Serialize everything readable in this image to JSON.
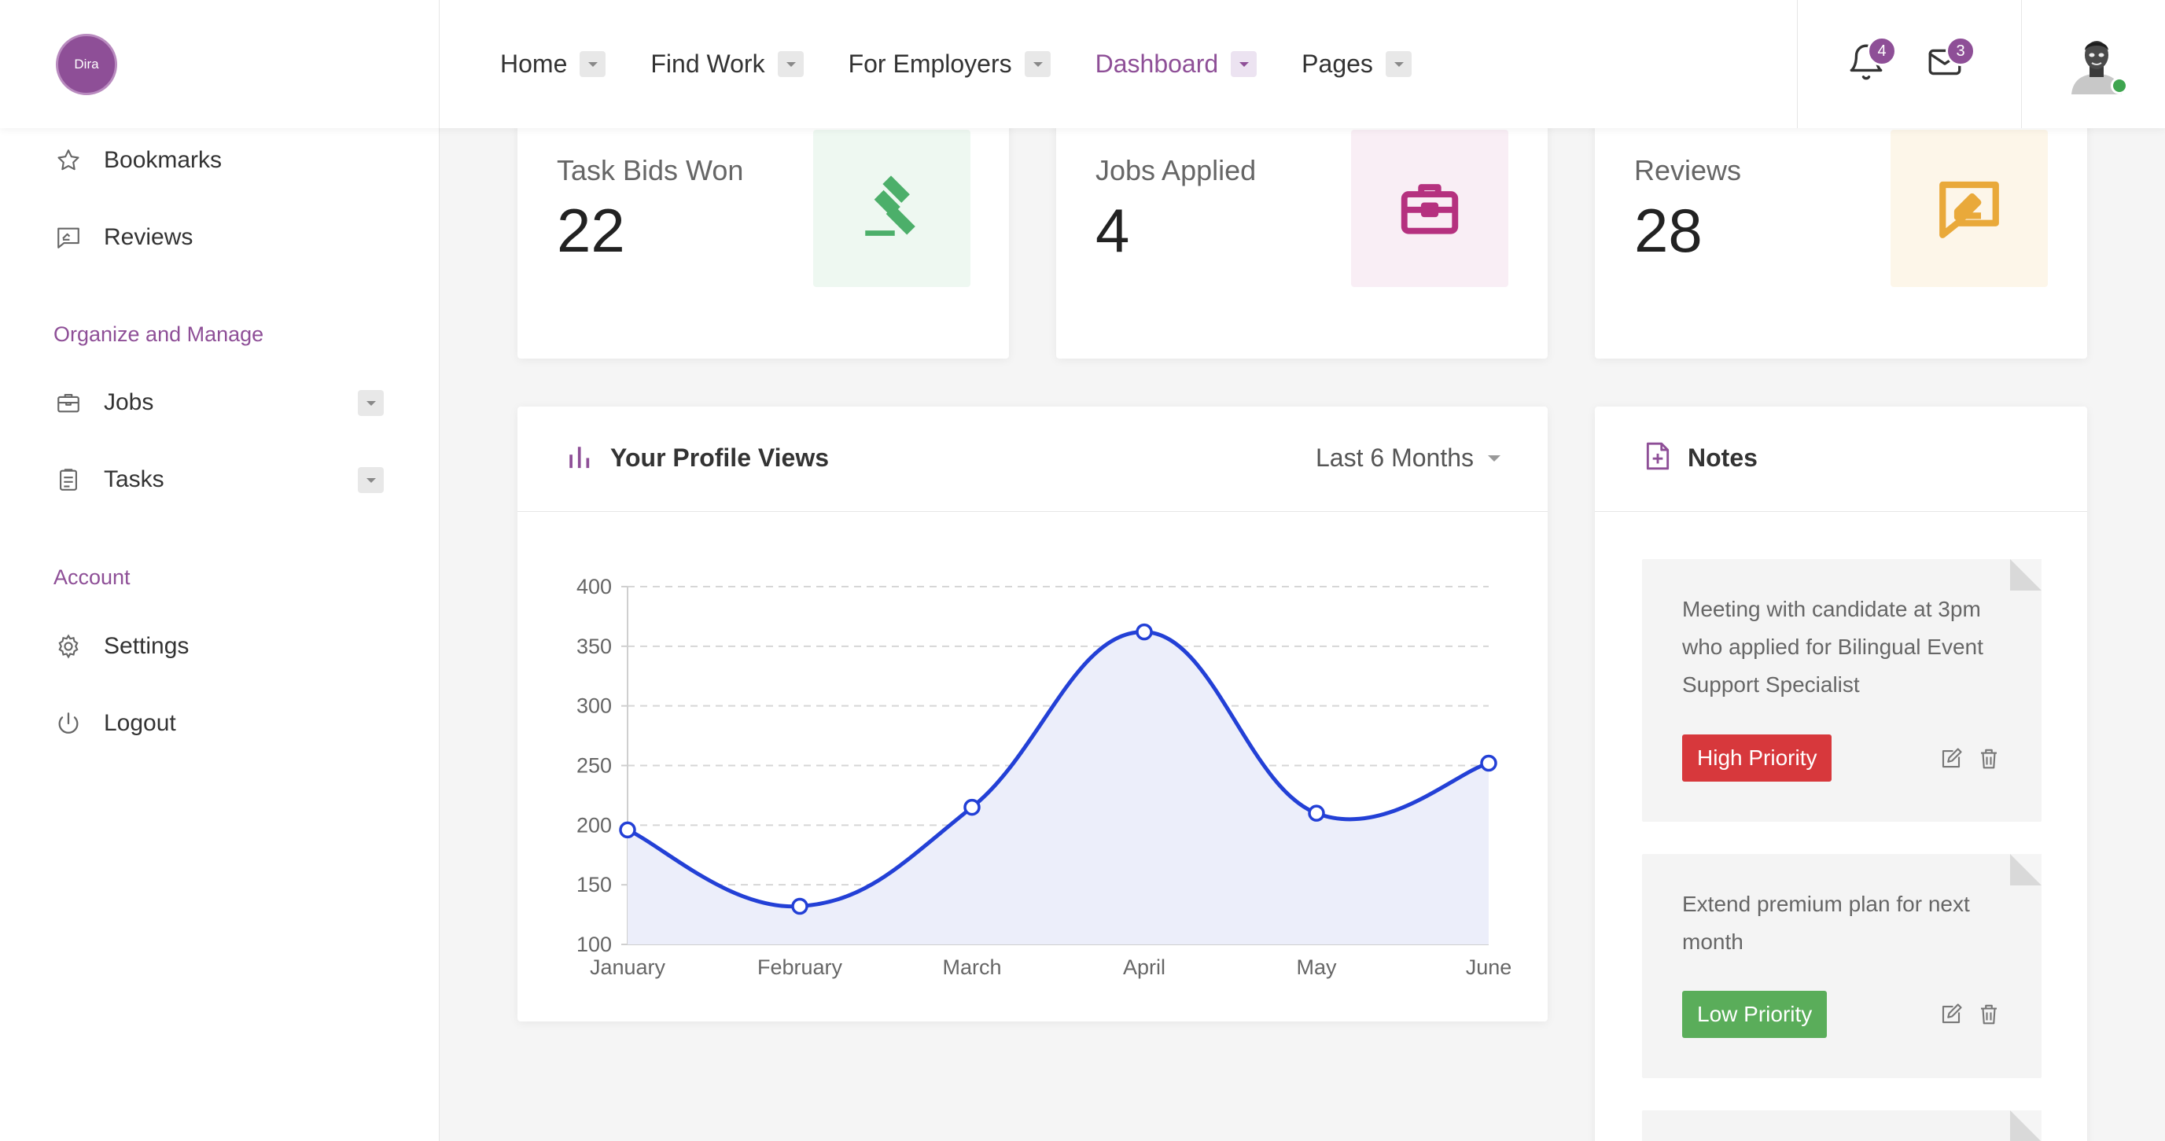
{
  "logo": {
    "text": "Dira"
  },
  "nav": {
    "items": [
      {
        "label": "Home",
        "active": false
      },
      {
        "label": "Find Work",
        "active": false
      },
      {
        "label": "For Employers",
        "active": false
      },
      {
        "label": "Dashboard",
        "active": true
      },
      {
        "label": "Pages",
        "active": false
      }
    ]
  },
  "header": {
    "notifications_count": "4",
    "messages_count": "3",
    "notifications_icon": "bell-icon",
    "messages_icon": "envelope-icon",
    "user_status": "online"
  },
  "sidebar": {
    "items_top": [
      {
        "label": "Bookmarks",
        "icon": "star-icon"
      },
      {
        "label": "Reviews",
        "icon": "review-icon"
      }
    ],
    "section_organize": "Organize and Manage",
    "items_organize": [
      {
        "label": "Jobs",
        "icon": "briefcase-icon",
        "expandable": true
      },
      {
        "label": "Tasks",
        "icon": "clipboard-icon",
        "expandable": true
      }
    ],
    "section_account": "Account",
    "items_account": [
      {
        "label": "Settings",
        "icon": "gear-icon"
      },
      {
        "label": "Logout",
        "icon": "power-icon"
      }
    ]
  },
  "stats": [
    {
      "label": "Task Bids Won",
      "value": "22",
      "icon": "gavel-icon",
      "color": "#4caf6a",
      "bg": "#eef8f1"
    },
    {
      "label": "Jobs Applied",
      "value": "4",
      "icon": "briefcase-icon",
      "color": "#b5317f",
      "bg": "#f9eef5"
    },
    {
      "label": "Reviews",
      "value": "28",
      "icon": "review-icon",
      "color": "#e9a93a",
      "bg": "#fdf6e9"
    }
  ],
  "profile_views": {
    "title": "Your Profile Views",
    "period": "Last 6 Months"
  },
  "chart_data": {
    "type": "area",
    "categories": [
      "January",
      "February",
      "March",
      "April",
      "May",
      "June"
    ],
    "values": [
      196,
      132,
      215,
      362,
      210,
      252
    ],
    "ylim": [
      100,
      400
    ],
    "yticks": [
      100,
      150,
      200,
      250,
      300,
      350,
      400
    ],
    "xlabel": "",
    "ylabel": "",
    "grid": "horizontal-dashed",
    "color": "#2340d6",
    "fill": "#eceefa"
  },
  "notes": {
    "title": "Notes",
    "items": [
      {
        "text": "Meeting with candidate at 3pm who applied for Bilingual Event Support Specialist",
        "priority": "High Priority",
        "color": "#d7383c"
      },
      {
        "text": "Extend premium plan for next month",
        "priority": "Low Priority",
        "color": "#5aad5a"
      }
    ]
  }
}
